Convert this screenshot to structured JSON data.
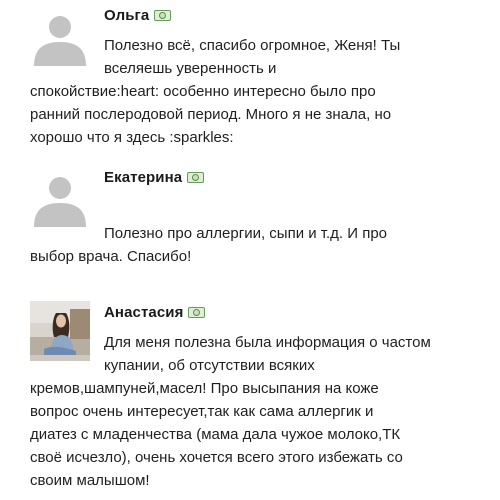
{
  "comments": [
    {
      "author": "Ольга",
      "badge_icon": "money-icon",
      "avatar": "default-avatar",
      "lines": [
        "Полезно всё, спасибо огромное, Женя! Ты",
        "вселяешь уверенность и",
        "спокойствие:heart: особенно интересно было про",
        "ранний послеродовой период. Много я не знала, но",
        "хорошо что я здесь :sparkles:"
      ]
    },
    {
      "author": "Екатерина",
      "badge_icon": "money-icon",
      "avatar": "default-avatar",
      "lines": [
        "Полезно про аллергии, сыпи и т.д. И про",
        "выбор врача. Спасибо!"
      ]
    },
    {
      "author": "Анастасия",
      "badge_icon": "money-icon",
      "avatar": "photo-avatar",
      "lines": [
        "Для меня полезна была информация о частом",
        "купании, об отсутствии всяких",
        "кремов,шампуней,масел! Про высыпания на коже",
        "вопрос очень интересует,так как сама аллергик и",
        "диатез с младенчества (мама дала чужое молоко,ТК",
        "своё исчезло), очень хочется всего этого избежать со",
        "своим малышом!"
      ]
    }
  ]
}
